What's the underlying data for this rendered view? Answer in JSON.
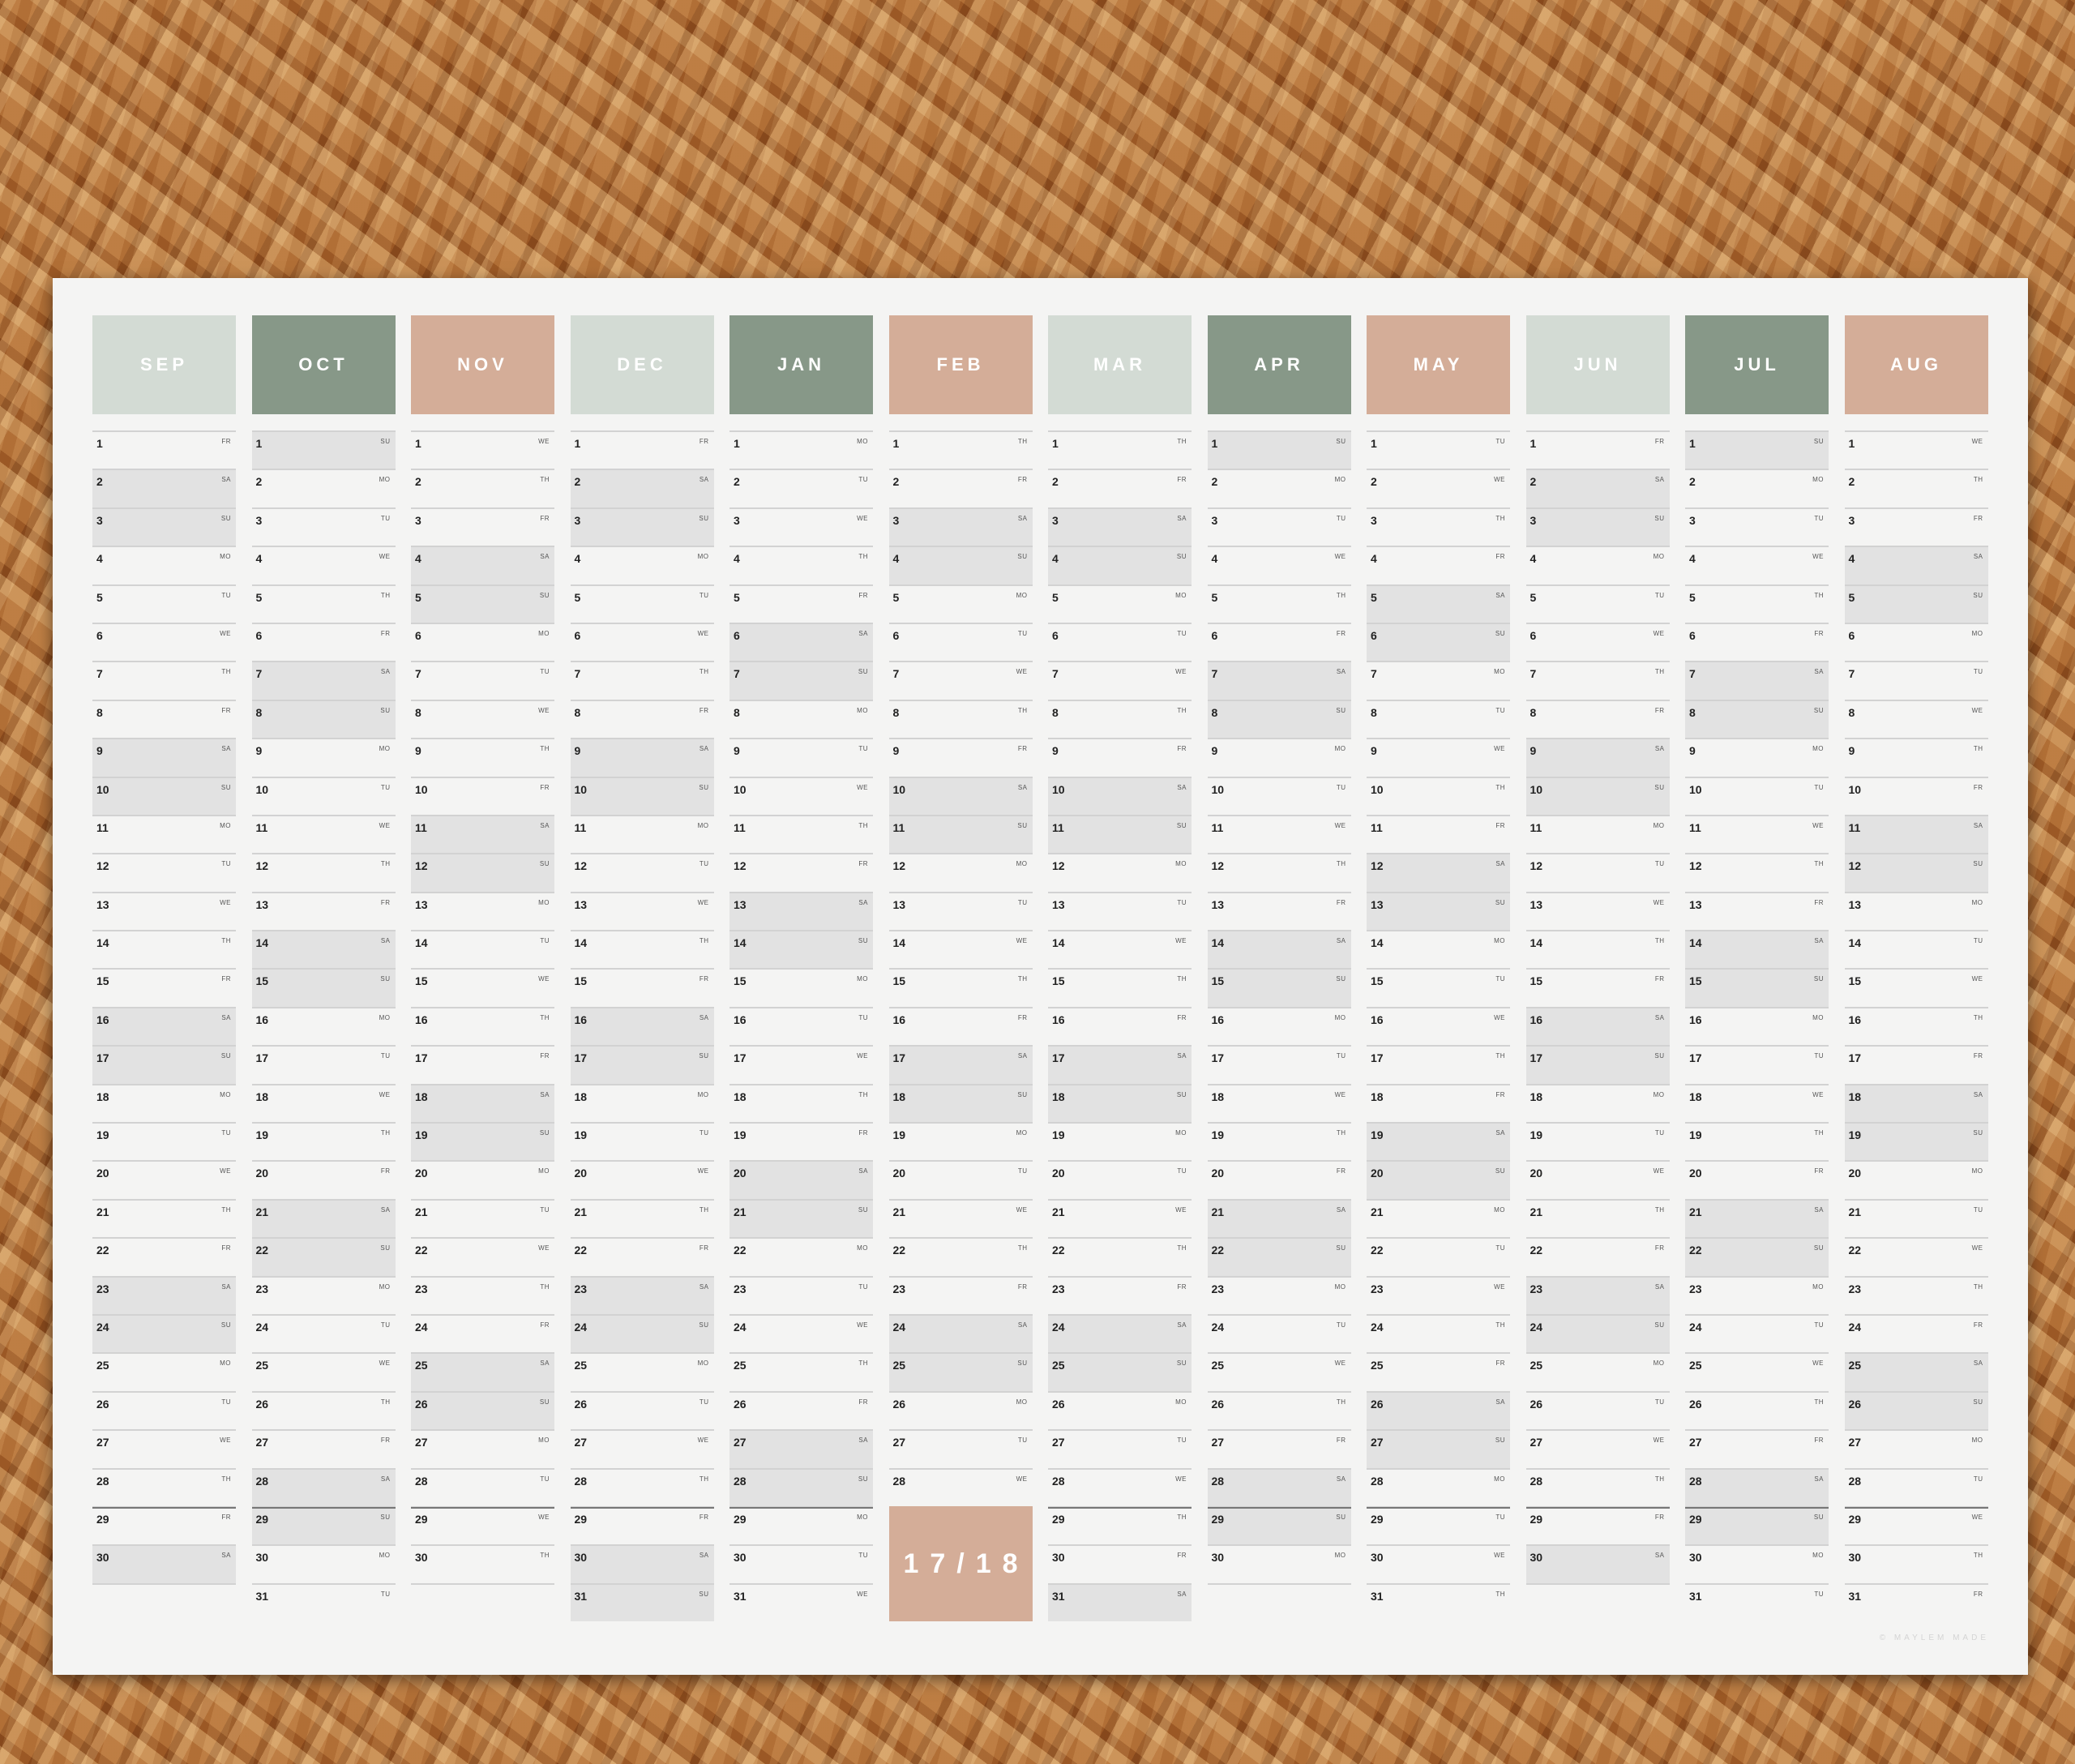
{
  "colors": {
    "light_sage": "#d3dbd4",
    "sage": "#879888",
    "peach": "#d4ad98",
    "weekend": "#e2e2e2"
  },
  "weekday_labels": [
    "MO",
    "TU",
    "WE",
    "TH",
    "FR",
    "SA",
    "SU"
  ],
  "months": [
    {
      "name": "SEP",
      "color": "#d3dbd4",
      "days": 30,
      "first": "FR"
    },
    {
      "name": "OCT",
      "color": "#879888",
      "days": 31,
      "first": "SU"
    },
    {
      "name": "NOV",
      "color": "#d4ad98",
      "days": 30,
      "first": "WE"
    },
    {
      "name": "DEC",
      "color": "#d3dbd4",
      "days": 31,
      "first": "FR"
    },
    {
      "name": "JAN",
      "color": "#879888",
      "days": 31,
      "first": "MO"
    },
    {
      "name": "FEB",
      "color": "#d4ad98",
      "days": 28,
      "first": "TH"
    },
    {
      "name": "MAR",
      "color": "#d3dbd4",
      "days": 31,
      "first": "TH"
    },
    {
      "name": "APR",
      "color": "#879888",
      "days": 30,
      "first": "SU"
    },
    {
      "name": "MAY",
      "color": "#d4ad98",
      "days": 31,
      "first": "TU"
    },
    {
      "name": "JUN",
      "color": "#d3dbd4",
      "days": 30,
      "first": "FR"
    },
    {
      "name": "JUL",
      "color": "#879888",
      "days": 31,
      "first": "SU"
    },
    {
      "name": "AUG",
      "color": "#d4ad98",
      "days": 31,
      "first": "WE"
    }
  ],
  "year_badge": "17/18",
  "copyright": "© MAYLEM MADE"
}
